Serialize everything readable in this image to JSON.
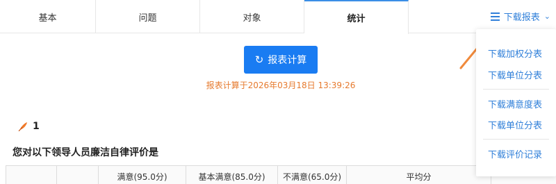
{
  "tabs": [
    {
      "label": "基本"
    },
    {
      "label": "问题"
    },
    {
      "label": "对象"
    },
    {
      "label": "统计"
    }
  ],
  "download": {
    "label": "下载报表",
    "icon": "menu-icon",
    "menu": [
      {
        "label": "下载加权分表"
      },
      {
        "label": "下载单位分表"
      },
      {
        "label": "下载满意度表"
      },
      {
        "label": "下载单位分表"
      },
      {
        "label": "下载评价记录"
      }
    ]
  },
  "calc": {
    "button_label": "报表计算",
    "time_text": "报表计算于2026年03月18日 13:39:26"
  },
  "question": {
    "number": "1",
    "title": "您对以下领导人员廉洁自律评价是"
  },
  "table": {
    "headers": [
      "",
      "",
      "满意(95.0分)",
      "基本满意(85.0分)",
      "不满意(65.0分)",
      "平均分",
      ""
    ]
  },
  "colors": {
    "accent": "#1a7cf2",
    "link": "#2f7fd9",
    "time": "#e67a2e",
    "arrow": "#f08a3c"
  }
}
